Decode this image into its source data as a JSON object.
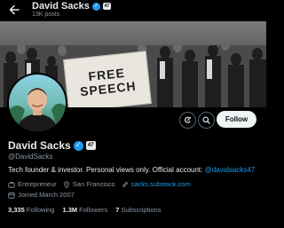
{
  "header": {
    "name": "David Sacks",
    "posts_count": "13K posts"
  },
  "banner": {
    "sign_line1": "FREE",
    "sign_line2": "SPEECH"
  },
  "actions": {
    "follow_label": "Follow"
  },
  "profile": {
    "name": "David Sacks",
    "handle": "@DavidSacks",
    "bio_text": "Tech founder & investor. Personal views only. Official account: ",
    "bio_mention": "@davidsacks47",
    "category": "Entrepreneur",
    "location": "San Francisco",
    "website": "sacks.substack.com",
    "joined": "Joined March 2007"
  },
  "stats": {
    "following_count": "3,335",
    "following_label": "Following",
    "followers_count": "1.3M",
    "followers_label": "Followers",
    "subscriptions_count": "7",
    "subscriptions_label": "Subscriptions"
  },
  "colors": {
    "accent": "#1d9bf0",
    "background": "#000000",
    "muted_text": "#8b98a5"
  },
  "icons": [
    "back-arrow-icon",
    "verified-badge-icon",
    "affiliate-badge-icon",
    "grok-icon",
    "search-icon",
    "briefcase-icon",
    "location-pin-icon",
    "link-icon",
    "calendar-icon"
  ]
}
